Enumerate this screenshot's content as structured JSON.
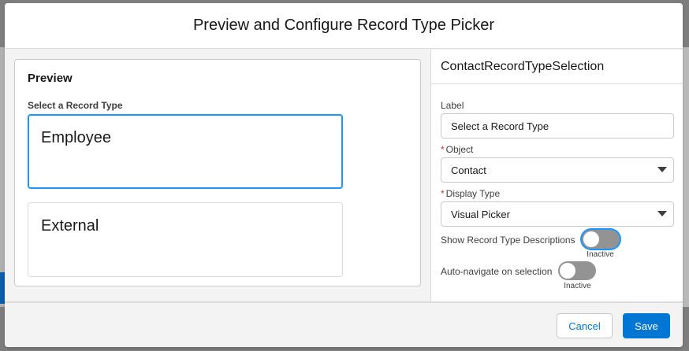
{
  "modal": {
    "title": "Preview and Configure Record Type Picker"
  },
  "preview": {
    "title": "Preview",
    "sublabel": "Select a Record Type",
    "record_types": [
      {
        "label": "Employee",
        "selected": true
      },
      {
        "label": "External",
        "selected": false
      }
    ]
  },
  "config": {
    "component_name": "ContactRecordTypeSelection",
    "label_field": {
      "label": "Label",
      "value": "Select a Record Type"
    },
    "object_field": {
      "label": "Object",
      "required_marker": "*",
      "value": "Contact"
    },
    "display_type_field": {
      "label": "Display Type",
      "required_marker": "*",
      "value": "Visual Picker"
    },
    "show_descriptions": {
      "label": "Show Record Type Descriptions",
      "state": "Inactive"
    },
    "auto_navigate": {
      "label": "Auto-navigate on selection",
      "state": "Inactive"
    }
  },
  "footer": {
    "cancel_label": "Cancel",
    "save_label": "Save"
  },
  "colors": {
    "brand": "#0176d3",
    "focus": "#1b96ff",
    "required": "#c23934",
    "toggle_off": "#939393"
  }
}
